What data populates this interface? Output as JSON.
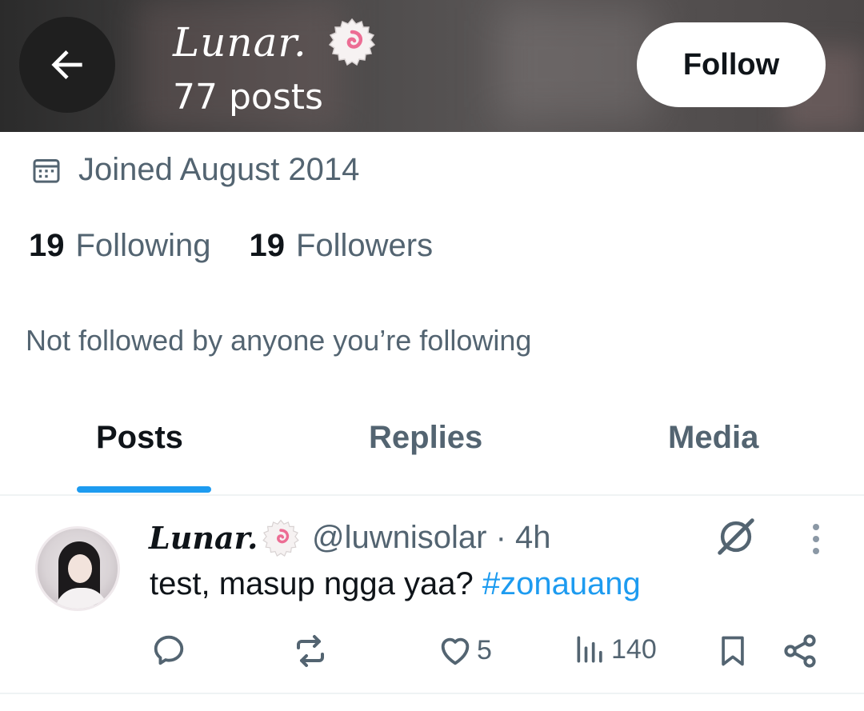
{
  "header": {
    "display_name": "Lunar.",
    "post_count": "77 posts",
    "follow_label": "Follow"
  },
  "profile": {
    "joined": "Joined August 2014",
    "following_count": "19",
    "following_label": "Following",
    "followers_count": "19",
    "followers_label": "Followers",
    "not_followed": "Not followed by anyone you’re following"
  },
  "tabs": [
    {
      "label": "Posts",
      "active": true
    },
    {
      "label": "Replies",
      "active": false
    },
    {
      "label": "Media",
      "active": false
    }
  ],
  "post": {
    "display_name": "Lunar.",
    "meta": "@luwnisolar · 4h",
    "text": "test, masup ngga yaa? ",
    "hashtag": "#zonauang",
    "likes": "5",
    "views": "140"
  },
  "colors": {
    "accent": "#1d9bf0",
    "secondary_text": "#536471",
    "primary_text": "#0f1419"
  },
  "icons": [
    "back-arrow-icon",
    "narutomaki-emoji-icon",
    "calendar-icon",
    "grok-icon",
    "more-icon",
    "reply-icon",
    "repost-icon",
    "like-icon",
    "views-icon",
    "bookmark-icon",
    "share-icon"
  ]
}
